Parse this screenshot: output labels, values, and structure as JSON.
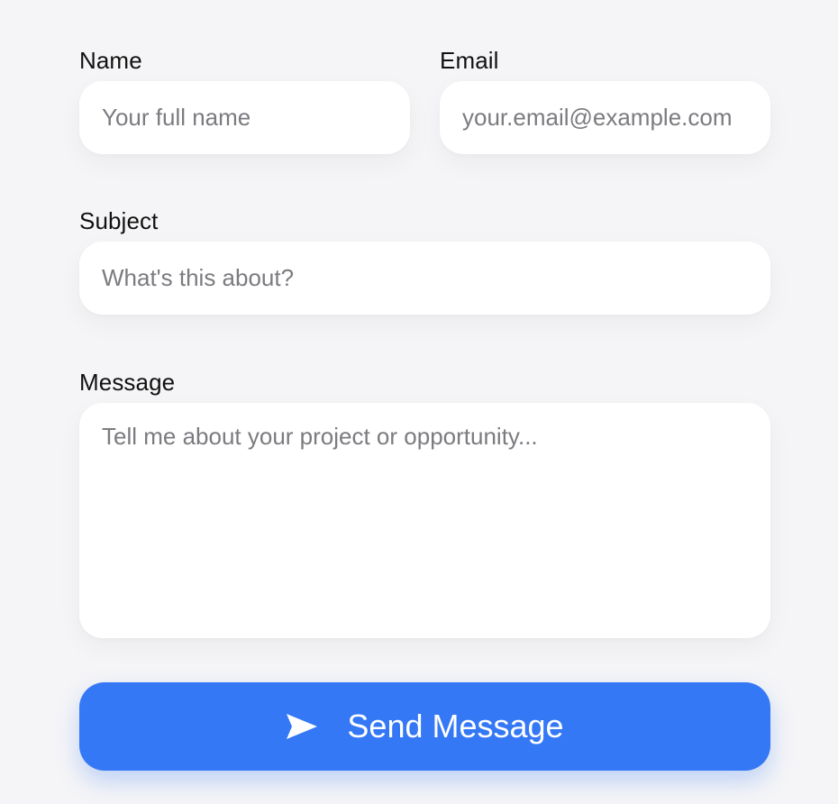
{
  "form": {
    "name": {
      "label": "Name",
      "placeholder": "Your full name",
      "value": ""
    },
    "email": {
      "label": "Email",
      "placeholder": "your.email@example.com",
      "value": ""
    },
    "subject": {
      "label": "Subject",
      "placeholder": "What's this about?",
      "value": ""
    },
    "message": {
      "label": "Message",
      "placeholder": "Tell me about your project or opportunity...",
      "value": ""
    },
    "submit": {
      "label": "Send Message",
      "icon": "paper-plane-icon"
    }
  },
  "colors": {
    "background": "#f5f5f7",
    "field_background": "#ffffff",
    "accent": "#3478f6",
    "label_text": "#111111",
    "placeholder_text": "#7b7b80"
  }
}
